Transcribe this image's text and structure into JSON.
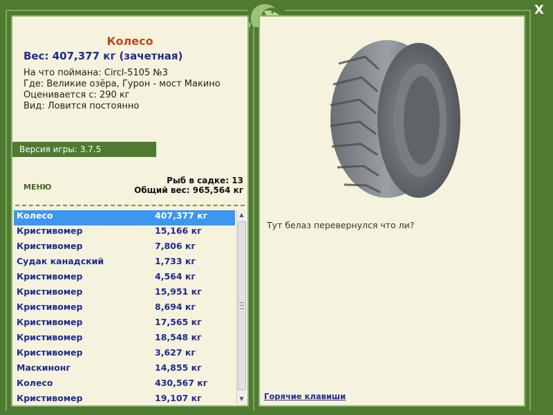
{
  "window": {
    "close_label": "X"
  },
  "fish": {
    "name": "Колесо",
    "weight": "Вес: 407,377 кг (зачетная)",
    "details": [
      "На что поймана: Circl-5105 №3",
      "Где: Великие озёра, Гурон - мост Макино",
      "Оценивается с: 290 кг",
      "Вид: Ловится постоянно"
    ]
  },
  "version": "Версия игры: 3.7.5",
  "menu_label": "МЕНЮ",
  "stats": {
    "count": "Рыб в садке: 13",
    "total_weight": "Общий вес: 965,564 кг"
  },
  "catch_list": [
    {
      "name": "Колесо",
      "weight": "407,377 кг",
      "selected": true
    },
    {
      "name": "Кристивомер",
      "weight": "15,166 кг"
    },
    {
      "name": "Кристивомер",
      "weight": "7,806 кг"
    },
    {
      "name": "Судак канадский",
      "weight": "1,733 кг"
    },
    {
      "name": "Кристивомер",
      "weight": "4,564 кг"
    },
    {
      "name": "Кристивомер",
      "weight": "15,951 кг"
    },
    {
      "name": "Кристивомер",
      "weight": "8,694 кг"
    },
    {
      "name": "Кристивомер",
      "weight": "17,565 кг"
    },
    {
      "name": "Кристивомер",
      "weight": "18,548 кг"
    },
    {
      "name": "Кристивомер",
      "weight": "3,627 кг"
    },
    {
      "name": "Маскинонг",
      "weight": "14,855 кг"
    },
    {
      "name": "Колесо",
      "weight": "430,567 кг"
    },
    {
      "name": "Кристивомер",
      "weight": "19,107 кг"
    }
  ],
  "comment": "Тут белаз перевернулся что ли?",
  "hotkeys_label": "Горячие клавиши",
  "colors": {
    "frame": "#4f7a32",
    "panel": "#f5f2dd",
    "selected_row": "#3c96f2",
    "list_text": "#1e2a8f",
    "title": "#c0471c"
  },
  "icons": {
    "close": "x-icon",
    "logo": "fish-logo-icon",
    "item_image": "tire-image"
  }
}
